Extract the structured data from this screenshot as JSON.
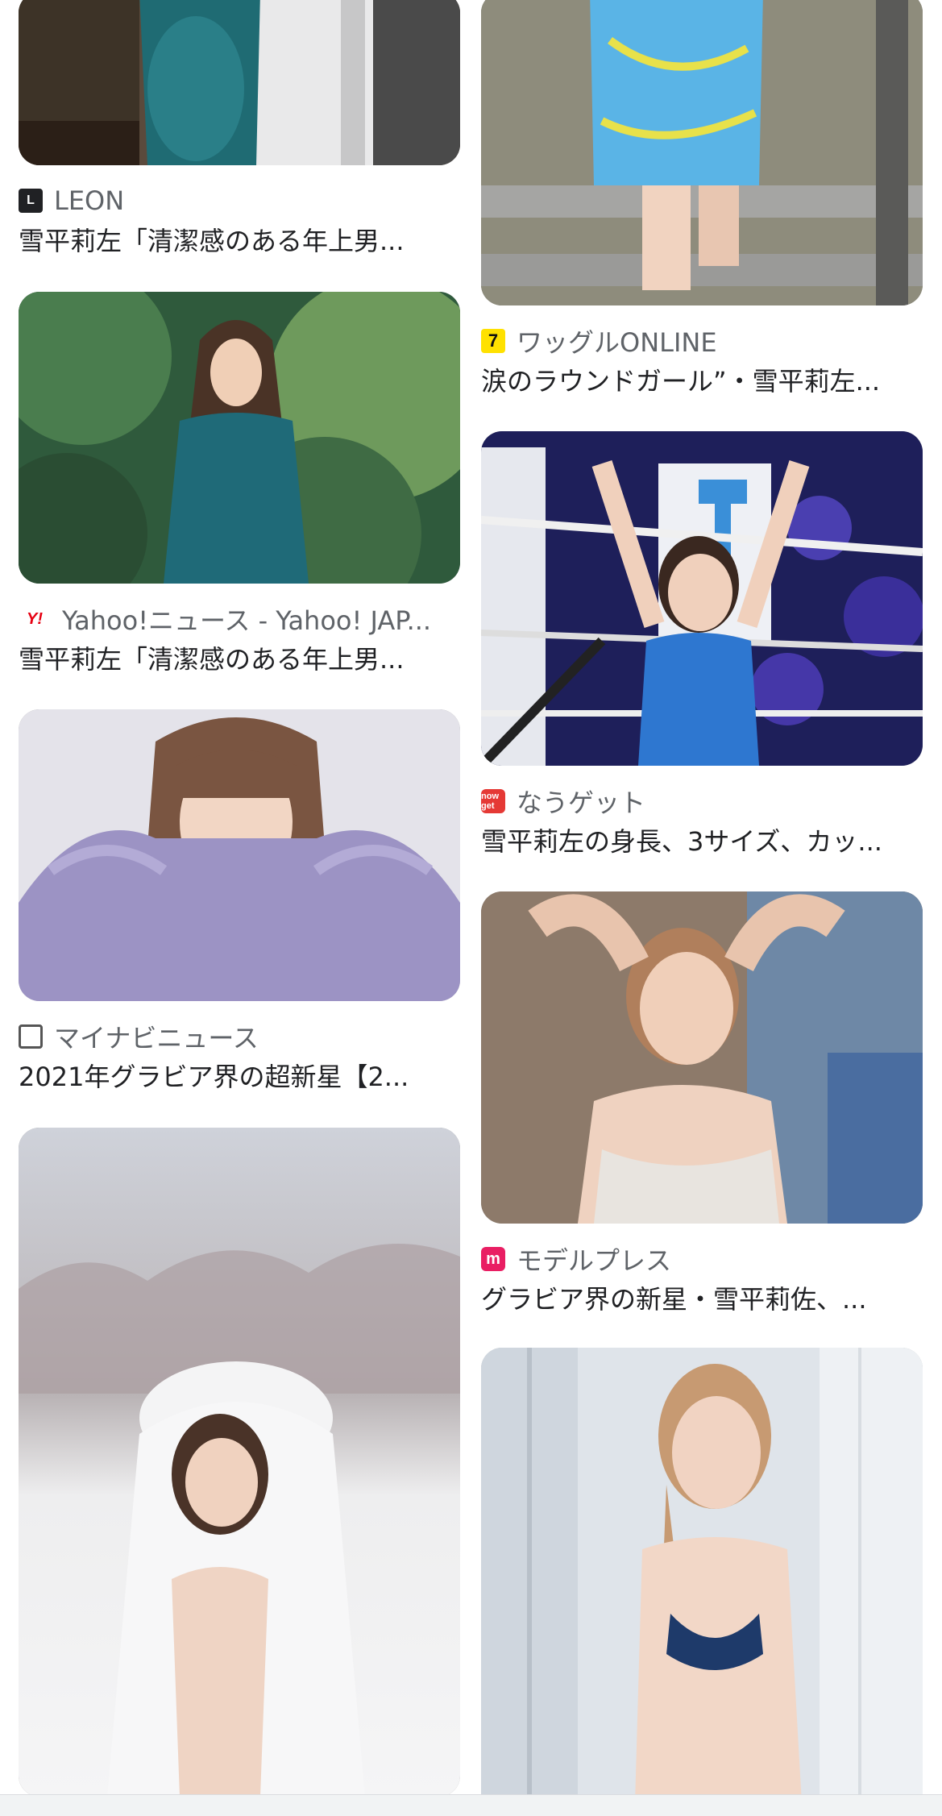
{
  "results": [
    {
      "source": "LEON",
      "logo_text": "L",
      "title": "雪平莉左「清潔感のある年上男..."
    },
    {
      "source": "Yahoo!ニュース - Yahoo! JAP...",
      "logo_text": "Y!",
      "title": "雪平莉左「清潔感のある年上男..."
    },
    {
      "source": "マイナビニュース",
      "logo_text": "",
      "title": "2021年グラビア界の超新星【2..."
    },
    {
      "source": "",
      "logo_text": "",
      "title": ""
    },
    {
      "source": "ワッグルONLINE",
      "logo_text": "7",
      "title": "涙のラウンドガール”・雪平莉左..."
    },
    {
      "source": "なうゲット",
      "logo_text": "now get",
      "title": "雪平莉左の身長、3サイズ、カッ..."
    },
    {
      "source": "モデルプレス",
      "logo_text": "m",
      "title": "グラビア界の新星・雪平莉佐、..."
    },
    {
      "source": "",
      "logo_text": "",
      "title": ""
    }
  ]
}
